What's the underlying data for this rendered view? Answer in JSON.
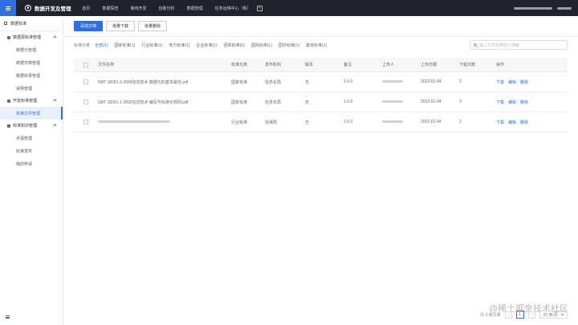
{
  "header": {
    "app_title": "数据开发及管理",
    "nav": [
      "首页",
      "数据探查",
      "离线开发",
      "自助分析",
      "数据管理",
      "任务运维中心（新）"
    ],
    "nav_plus": "+"
  },
  "sidebar": {
    "title": "数据标准",
    "groups": [
      {
        "label": "数据源标准管理",
        "items": [
          "数据元管理",
          "数据字典管理",
          "数据目录管理",
          "说明管理"
        ]
      },
      {
        "label": "开放标准管理",
        "items": [
          "标准文件管理"
        ]
      },
      {
        "label": "标准知识管理",
        "items": [
          "术语管理",
          "标准发布",
          "我的申请"
        ]
      }
    ]
  },
  "toolbar": {
    "add": "添加文档",
    "batch_download": "批量下载",
    "batch_delete": "批量删除"
  },
  "filter": {
    "label": "标准分类",
    "items": [
      "全部(3)",
      "国家标准(1)",
      "行业标准(1)",
      "地方标准(1)",
      "企业标准(1)",
      "团体标准(0)",
      "国际标准(1)",
      "国外标准(1)",
      "其他标准(1)"
    ]
  },
  "search": {
    "placeholder": "输入文件名称进行搜索"
  },
  "table": {
    "headers": [
      "文件名称",
      "标准分类",
      "发布机构",
      "版本",
      "备注",
      "上传人",
      "上传日期",
      "下载次数",
      "操作"
    ],
    "rows": [
      {
        "name": "GBT 18391.3-2009信息技术  数据元的基本属性.pdf",
        "cat": "国家标准",
        "org": "信息化局",
        "ver": "无",
        "note": "1.0.0",
        "date": "2022-01-04",
        "downloads": "3"
      },
      {
        "name": "GBT 18391.1-2002信息技术  编写与标准化规则.pdf",
        "cat": "国家标准",
        "org": "信息化局",
        "ver": "无",
        "note": "1.0.0",
        "date": "2022-01-04",
        "downloads": "3"
      },
      {
        "name": "",
        "cat": "行业标准",
        "org": "信保局",
        "ver": "无",
        "note": "1.0.0",
        "date": "2022-01-04",
        "downloads": "3"
      }
    ],
    "ops": [
      "下载",
      "编辑",
      "删除"
    ]
  },
  "pagination": {
    "total": "共 3 条记录",
    "page": "1",
    "page_size": "25 条/页"
  },
  "watermark": "@稀土掘金技术社区"
}
